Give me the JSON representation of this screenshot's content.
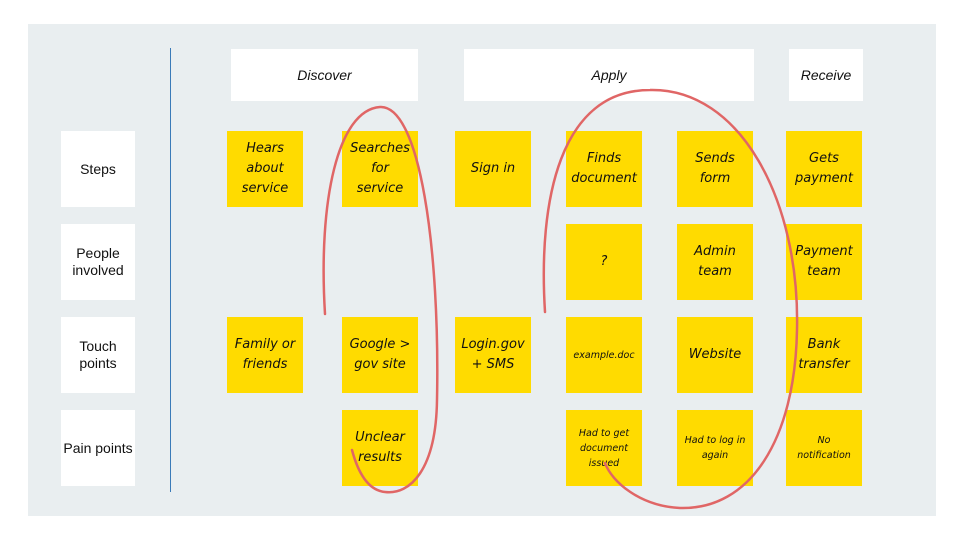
{
  "phases": [
    "Discover",
    "Apply",
    "Receive"
  ],
  "rows": [
    "Steps",
    "People involved",
    "Touch points",
    "Pain points"
  ],
  "notes": {
    "steps": [
      "Hears about service",
      "Searches for service",
      "Sign in",
      "Finds document",
      "Sends form",
      "Gets payment"
    ],
    "people": [
      "?",
      "Admin team",
      "Payment team"
    ],
    "touch": [
      "Family or friends",
      "Google > gov site",
      "Login.gov + SMS",
      "example.doc",
      "Website",
      "Bank transfer"
    ],
    "pain": [
      "Unclear results",
      "Had to get document issued",
      "Had to log in again",
      "No notification"
    ]
  },
  "colors": {
    "note": "#ffdb00",
    "annotation": "#e06666",
    "panel": "#e9eef0",
    "divider": "#3a7ab8"
  }
}
